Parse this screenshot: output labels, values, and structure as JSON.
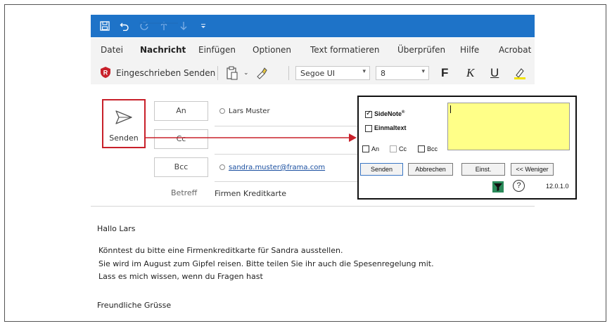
{
  "menu": {
    "items": [
      "Datei",
      "Nachricht",
      "Einfügen",
      "Optionen",
      "Text formatieren",
      "Überprüfen",
      "Hilfe",
      "Acrobat"
    ]
  },
  "ribbon": {
    "registered_send": "Eingeschrieben Senden",
    "font_name": "Segoe UI",
    "font_size": "8",
    "bold": "F",
    "italic": "K",
    "underline": "U"
  },
  "compose": {
    "send_label": "Senden",
    "to_label": "An",
    "cc_label": "Cc",
    "bcc_label": "Bcc",
    "to_value": "Lars Muster",
    "bcc_value": "sandra.muster@frama.com",
    "subject_label": "Betreff",
    "subject_value": "Firmen Kreditkarte"
  },
  "sidenote": {
    "sidenote_label": "SideNote",
    "sidenote_mark": "®",
    "sidenote_checked": true,
    "einmaltext_label": "Einmaltext",
    "an_label": "An",
    "cc_label": "Cc",
    "bcc_label": "Bcc",
    "send_button": "Senden",
    "cancel_button": "Abbrechen",
    "settings_button": "Einst.",
    "less_button": "<< Weniger",
    "version": "12.0.1.0"
  },
  "body": {
    "greeting": "Hallo Lars",
    "line1": "Könntest du bitte eine Firmenkreditkarte für Sandra ausstellen.",
    "line2": "Sie wird im August zum Gipfel reisen. Bitte teilen Sie ihr auch die Spesenregelung mit.",
    "line3": "Lass es mich wissen, wenn du Fragen hast",
    "closing": "Freundliche Grüsse"
  },
  "colors": {
    "titlebar": "#1e73c8",
    "highlight": "#c8202a",
    "note_bg": "#ffff88"
  }
}
